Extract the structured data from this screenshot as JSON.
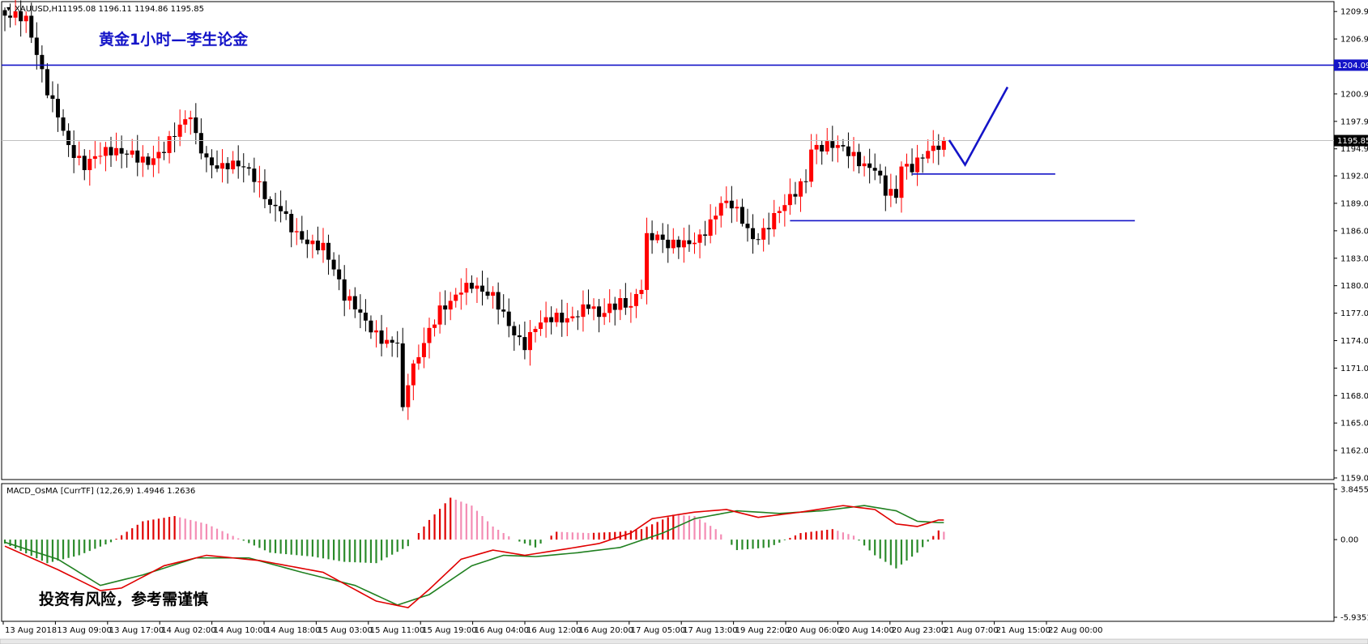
{
  "header": {
    "symbol": "XAUUSD,H1",
    "ohlc": "1195.08 1196.11 1194.86 1195.85",
    "title_cn": "黄金1小时—李生论金"
  },
  "macd_panel": {
    "label": "MACD_OsMA [CurrTF] (12,26,9) 1.4946 1.2636",
    "risk_note": "投资有风险，参考需谨慎"
  },
  "colors": {
    "bull": "#ff0000",
    "bear": "#000000",
    "annotation": "#1414c8",
    "hist_pos_up": "#e00000",
    "hist_pos_down": "#f48cb4",
    "hist_neg_down": "#2a8a2a",
    "macd_line": "#e00000",
    "signal_line": "#208020"
  },
  "chart_data": [
    {
      "type": "candlestick",
      "symbol": "XAUUSD",
      "timeframe": "H1",
      "ylim": [
        1159.0,
        1210.5
      ],
      "y_ticks": [
        "1209.95",
        "1206.95",
        "1203.95",
        "1200.95",
        "1197.95",
        "1194.95",
        "1192.00",
        "1189.00",
        "1186.00",
        "1183.00",
        "1180.00",
        "1177.00",
        "1174.00",
        "1171.00",
        "1168.00",
        "1165.00",
        "1162.00",
        "1159.00"
      ],
      "current_price": "1195.85",
      "horizontal_line_label": "1204.09",
      "x_ticks": [
        "13 Aug 2018",
        "13 Aug 09:00",
        "13 Aug 17:00",
        "14 Aug 02:00",
        "14 Aug 10:00",
        "14 Aug 18:00",
        "15 Aug 03:00",
        "15 Aug 11:00",
        "15 Aug 19:00",
        "16 Aug 04:00",
        "16 Aug 12:00",
        "16 Aug 20:00",
        "17 Aug 05:00",
        "17 Aug 13:00",
        "19 Aug 22:00",
        "20 Aug 06:00",
        "20 Aug 14:00",
        "20 Aug 23:00",
        "21 Aug 07:00",
        "21 Aug 15:00",
        "22 Aug 00:00"
      ],
      "close_path": [
        [
          0,
          1209.5
        ],
        [
          4,
          1208.2
        ],
        [
          6,
          1204.8
        ],
        [
          8,
          1201.5
        ],
        [
          10,
          1199.5
        ],
        [
          12,
          1196.0
        ],
        [
          15,
          1193.0
        ],
        [
          18,
          1193.6
        ],
        [
          21,
          1194.2
        ],
        [
          24,
          1195.0
        ],
        [
          27,
          1194.3
        ],
        [
          30,
          1194.8
        ],
        [
          33,
          1196.5
        ],
        [
          35,
          1198.0
        ],
        [
          36,
          1195.8
        ],
        [
          38,
          1194.0
        ],
        [
          40,
          1193.8
        ],
        [
          42,
          1194.0
        ],
        [
          44,
          1193.5
        ],
        [
          46,
          1192.0
        ],
        [
          48,
          1190.0
        ],
        [
          50,
          1188.0
        ],
        [
          52,
          1188.5
        ],
        [
          54,
          1187.0
        ],
        [
          56,
          1186.0
        ],
        [
          58,
          1185.0
        ],
        [
          60,
          1184.0
        ],
        [
          62,
          1181.0
        ],
        [
          64,
          1178.0
        ],
        [
          66,
          1177.5
        ],
        [
          68,
          1176.5
        ],
        [
          70,
          1175.5
        ],
        [
          72,
          1174.5
        ],
        [
          74,
          1174.0
        ],
        [
          75,
          1166.0
        ],
        [
          76,
          1169.0
        ],
        [
          78,
          1171.5
        ],
        [
          80,
          1174.5
        ],
        [
          82,
          1177.5
        ],
        [
          84,
          1179.0
        ],
        [
          86,
          1180.5
        ],
        [
          88,
          1180.5
        ],
        [
          90,
          1179.0
        ],
        [
          92,
          1178.0
        ],
        [
          94,
          1176.0
        ],
        [
          96,
          1174.5
        ],
        [
          98,
          1174.0
        ],
        [
          100,
          1176.5
        ],
        [
          102,
          1177.0
        ],
        [
          104,
          1176.5
        ],
        [
          106,
          1175.5
        ],
        [
          108,
          1176.0
        ],
        [
          110,
          1177.5
        ],
        [
          112,
          1177.0
        ],
        [
          114,
          1178.5
        ],
        [
          116,
          1179.0
        ],
        [
          118,
          1178.0
        ],
        [
          120,
          1179.5
        ],
        [
          121,
          1184.5
        ],
        [
          123,
          1184.5
        ],
        [
          125,
          1184.0
        ],
        [
          127,
          1185.0
        ],
        [
          129,
          1185.5
        ],
        [
          131,
          1186.0
        ],
        [
          133,
          1187.0
        ],
        [
          135,
          1188.5
        ],
        [
          137,
          1188.0
        ],
        [
          139,
          1186.5
        ],
        [
          141,
          1185.0
        ],
        [
          143,
          1186.5
        ],
        [
          145,
          1188.5
        ],
        [
          147,
          1189.5
        ],
        [
          149,
          1190.0
        ],
        [
          151,
          1190.8
        ],
        [
          152,
          1194.0
        ],
        [
          154,
          1194.5
        ],
        [
          156,
          1195.5
        ],
        [
          158,
          1195.8
        ],
        [
          160,
          1195.0
        ],
        [
          162,
          1193.5
        ],
        [
          164,
          1192.5
        ],
        [
          166,
          1189.5
        ],
        [
          168,
          1189.0
        ],
        [
          169,
          1192.5
        ],
        [
          171,
          1193.0
        ],
        [
          173,
          1195.0
        ],
        [
          175,
          1196.0
        ],
        [
          177,
          1195.85
        ]
      ],
      "annotations": {
        "horizontal_lines": [
          1204.09,
          1192.2,
          1187.1
        ],
        "projection_path": [
          [
            178,
            1195.9
          ],
          [
            181,
            1193.2
          ],
          [
            189,
            1201.7
          ]
        ]
      }
    },
    {
      "type": "macd_osma",
      "label": "MACD_OsMA [CurrTF] (12,26,9)",
      "macd": 1.4946,
      "signal": 1.2636,
      "ylim": [
        -5.9351,
        3.8455
      ],
      "y_ticks": [
        "3.8455",
        "0.00",
        "-5.9351"
      ],
      "osma_path": [
        [
          0,
          -0.3
        ],
        [
          8,
          -1.8
        ],
        [
          14,
          -1.2
        ],
        [
          20,
          -0.2
        ],
        [
          26,
          1.4
        ],
        [
          32,
          1.8
        ],
        [
          38,
          1.2
        ],
        [
          44,
          0.1
        ],
        [
          50,
          -1.0
        ],
        [
          58,
          -1.3
        ],
        [
          64,
          -1.7
        ],
        [
          70,
          -1.8
        ],
        [
          76,
          -0.5
        ],
        [
          80,
          1.5
        ],
        [
          84,
          3.2
        ],
        [
          88,
          2.6
        ],
        [
          92,
          1.0
        ],
        [
          96,
          0.0
        ],
        [
          100,
          -0.6
        ],
        [
          104,
          0.6
        ],
        [
          110,
          0.5
        ],
        [
          116,
          0.6
        ],
        [
          120,
          0.8
        ],
        [
          126,
          1.9
        ],
        [
          130,
          1.8
        ],
        [
          134,
          0.8
        ],
        [
          138,
          -0.8
        ],
        [
          144,
          -0.6
        ],
        [
          150,
          0.5
        ],
        [
          156,
          0.8
        ],
        [
          160,
          0.3
        ],
        [
          164,
          -1.2
        ],
        [
          168,
          -2.2
        ],
        [
          172,
          -1.0
        ],
        [
          176,
          0.7
        ],
        [
          178,
          0.5
        ]
      ],
      "macd_path": [
        [
          0,
          -0.5
        ],
        [
          10,
          -2.3
        ],
        [
          18,
          -3.9
        ],
        [
          22,
          -3.7
        ],
        [
          30,
          -2.0
        ],
        [
          38,
          -1.2
        ],
        [
          48,
          -1.6
        ],
        [
          60,
          -2.5
        ],
        [
          70,
          -4.7
        ],
        [
          76,
          -5.2
        ],
        [
          80,
          -3.8
        ],
        [
          86,
          -1.5
        ],
        [
          92,
          -0.8
        ],
        [
          98,
          -1.2
        ],
        [
          106,
          -0.7
        ],
        [
          112,
          -0.3
        ],
        [
          118,
          0.5
        ],
        [
          122,
          1.6
        ],
        [
          130,
          2.1
        ],
        [
          136,
          2.3
        ],
        [
          142,
          1.7
        ],
        [
          150,
          2.1
        ],
        [
          158,
          2.6
        ],
        [
          164,
          2.3
        ],
        [
          168,
          1.2
        ],
        [
          172,
          1.0
        ],
        [
          176,
          1.5
        ],
        [
          178,
          1.5
        ]
      ],
      "signal_path": [
        [
          0,
          -0.2
        ],
        [
          10,
          -1.5
        ],
        [
          18,
          -3.5
        ],
        [
          26,
          -2.7
        ],
        [
          36,
          -1.4
        ],
        [
          46,
          -1.4
        ],
        [
          56,
          -2.5
        ],
        [
          66,
          -3.5
        ],
        [
          74,
          -5.0
        ],
        [
          80,
          -4.2
        ],
        [
          88,
          -2.0
        ],
        [
          94,
          -1.2
        ],
        [
          100,
          -1.3
        ],
        [
          108,
          -1.0
        ],
        [
          116,
          -0.6
        ],
        [
          124,
          0.5
        ],
        [
          130,
          1.6
        ],
        [
          138,
          2.2
        ],
        [
          146,
          2.0
        ],
        [
          154,
          2.2
        ],
        [
          162,
          2.6
        ],
        [
          168,
          2.2
        ],
        [
          172,
          1.4
        ],
        [
          176,
          1.3
        ],
        [
          178,
          1.3
        ]
      ]
    }
  ]
}
